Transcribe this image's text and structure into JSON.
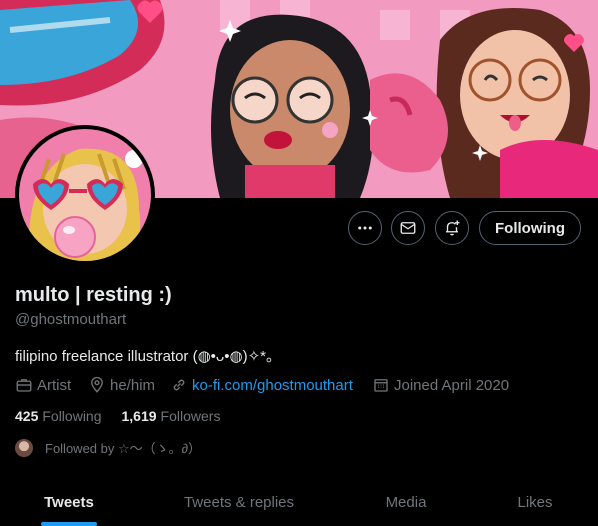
{
  "profile": {
    "name": "multo | resting :)",
    "handle": "@ghostmouthart",
    "bio": "filipino freelance illustrator (◍•ᴗ•◍)✧*。",
    "category": "Artist",
    "pronouns": "he/him",
    "link": "ko-fi.com/ghostmouthart",
    "joined": "Joined April 2020"
  },
  "actions": {
    "following_label": "Following"
  },
  "stats": {
    "following_count": "425",
    "following_label": "Following",
    "followers_count": "1,619",
    "followers_label": "Followers"
  },
  "followed_by": "Followed by ☆～（ゝ。∂）",
  "tabs": [
    {
      "label": "Tweets",
      "active": true
    },
    {
      "label": "Tweets & replies",
      "active": false
    },
    {
      "label": "Media",
      "active": false
    },
    {
      "label": "Likes",
      "active": false
    }
  ],
  "colors": {
    "background": "#000000",
    "text": "#e7e9ea",
    "muted": "#71767b",
    "accent": "#1d9bf0",
    "border": "#536471",
    "banner_pink": "#f08bb7"
  }
}
